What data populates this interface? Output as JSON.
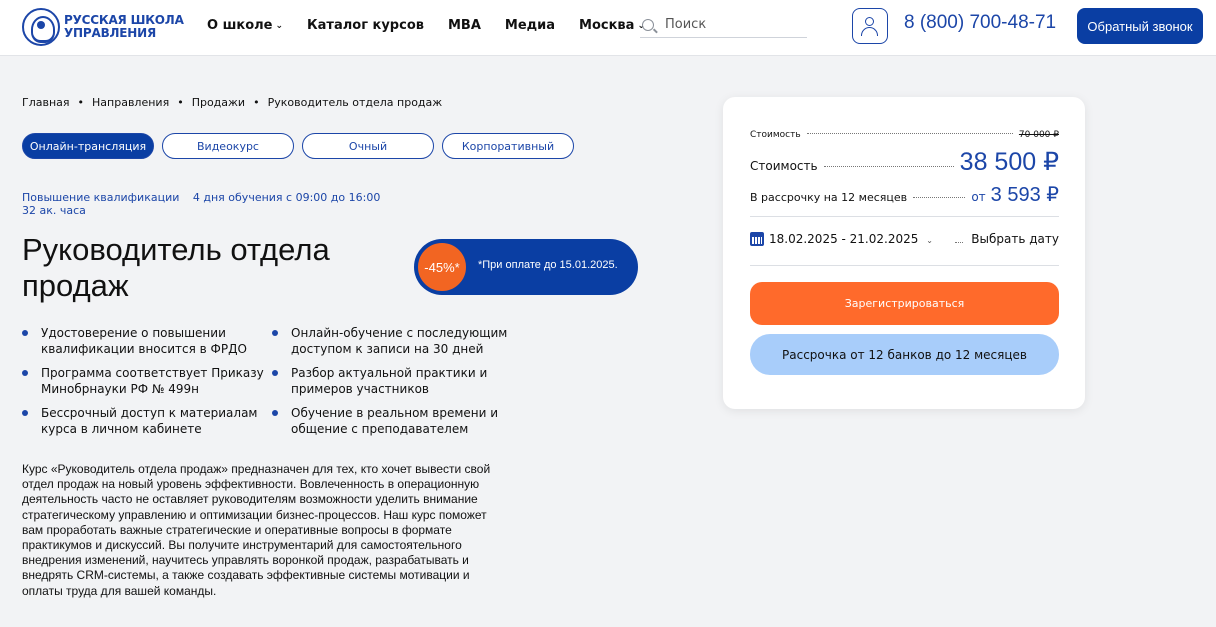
{
  "header": {
    "logo_line1": "РУССКАЯ ШКОЛА",
    "logo_line2": "УПРАВЛЕНИЯ",
    "nav": [
      {
        "label": "О школе",
        "has_dropdown": true
      },
      {
        "label": "Каталог курсов",
        "has_dropdown": false
      },
      {
        "label": "MBA",
        "has_dropdown": false
      },
      {
        "label": "Медиа",
        "has_dropdown": false
      },
      {
        "label": "Москва",
        "has_dropdown": true
      }
    ],
    "search_placeholder": "Поиск",
    "phone": "8 (800) 700-48-71",
    "callback_label": "Обратный звонок"
  },
  "breadcrumb": [
    "Главная",
    "Направления",
    "Продажи",
    "Руководитель отдела продаж"
  ],
  "format_tabs": [
    {
      "label": "Онлайн-трансляция",
      "active": true
    },
    {
      "label": "Видеокурс",
      "active": false
    },
    {
      "label": "Очный",
      "active": false
    },
    {
      "label": "Корпоративный",
      "active": false
    }
  ],
  "meta": {
    "type": "Повышение квалификации",
    "schedule": "4 дня обучения с 09:00 до 16:00",
    "hours": "32 ак. часа"
  },
  "title": "Руководитель отдела продаж",
  "promo": {
    "discount": "-45%*",
    "note": "*При оплате до 15.01.2025."
  },
  "features": [
    "Удостоверение о повышении квалификации вносится в ФРДО",
    "Онлайн-обучение с последующим доступом к записи на 30 дней",
    "Программа соответствует Приказу Минобрнауки РФ № 499н",
    "Разбор актуальной практики и примеров участников",
    "Бессрочный доступ к материалам курса в личном кабинете",
    "Обучение в реальном времени и общение с преподавателем"
  ],
  "description": "Курс «Руководитель отдела продаж» предназначен для тех, кто хочет вывести свой отдел продаж на новый уровень эффективности. Вовлеченность в операционную деятельность часто не оставляет руководителям возможности уделить внимание стратегическому управлению и оптимизации бизнес-процессов. Наш курс поможет вам проработать важные стратегические и оперативные вопросы в формате практикумов и дискуссий. Вы получите инструментарий для самостоятельного внедрения изменений, научитесь управлять воронкой продаж, разрабатывать и внедрять CRM-системы, а также создавать эффективные системы мотивации и оплаты труда для вашей команды.",
  "pricing": {
    "old_label": "Стоимость",
    "old_price": "70 000 ₽",
    "price_label": "Стоимость",
    "price": "38 500 ₽",
    "installment_label": "В рассрочку на 12 месяцев",
    "installment_from": "от",
    "installment_price": "3 593 ₽",
    "dates": "18.02.2025 - 21.02.2025",
    "choose_date": "Выбрать дату",
    "register_label": "Зарегистрироваться",
    "installment_button": "Рассрочка от 12 банков до 12 месяцев"
  },
  "colors": {
    "brand_blue": "#0a3ea3",
    "accent_orange": "#ff6a2b",
    "light_blue": "#a8cdfa"
  }
}
